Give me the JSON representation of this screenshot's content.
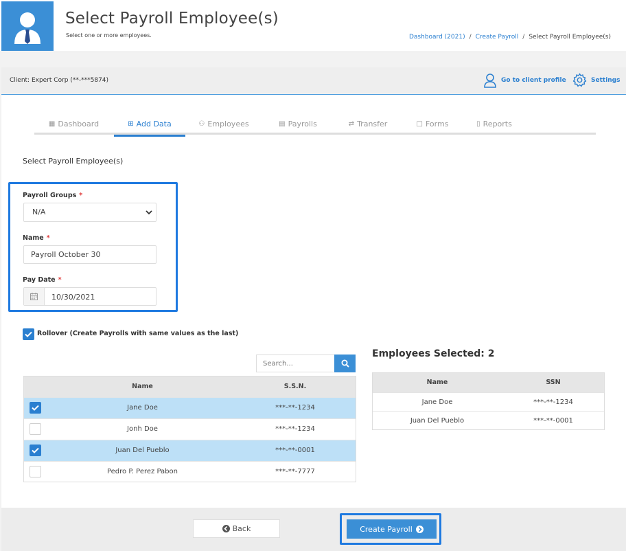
{
  "header": {
    "title": "Select Payroll Employee(s)",
    "subtitle": "Select one or more employees.",
    "breadcrumb": [
      {
        "label": "Dashboard (2021)",
        "link": true
      },
      {
        "label": "Create Payroll",
        "link": true
      },
      {
        "label": "Select Payroll Employee(s)",
        "link": false
      }
    ],
    "breadcrumb_sep": "/"
  },
  "client_bar": {
    "client_label": "Client: Expert Corp (**-***5874)",
    "profile_label": "Go to client profile",
    "settings_label": "Settings"
  },
  "tabs": [
    {
      "label": "Dashboard",
      "icon": "grid-icon",
      "active": false
    },
    {
      "label": "Add Data",
      "icon": "plus-square-icon",
      "active": true
    },
    {
      "label": "Employees",
      "icon": "users-icon",
      "active": false
    },
    {
      "label": "Payrolls",
      "icon": "money-icon",
      "active": false
    },
    {
      "label": "Transfer",
      "icon": "exchange-icon",
      "active": false
    },
    {
      "label": "Forms",
      "icon": "file-icon",
      "active": false
    },
    {
      "label": "Reports",
      "icon": "clipboard-icon",
      "active": false
    }
  ],
  "form": {
    "section_title": "Select Payroll Employee(s)",
    "payroll_groups_label": "Payroll Groups",
    "payroll_groups_value": "N/A",
    "name_label": "Name",
    "name_value": "Payroll October 30",
    "pay_date_label": "Pay Date",
    "pay_date_value": "10/30/2021",
    "required_mark": "*",
    "rollover_label": "Rollover (Create Payrolls with same values as the last)",
    "rollover_checked": true
  },
  "search": {
    "placeholder": "Search..."
  },
  "employees_table": {
    "columns": [
      "Name",
      "S.S.N."
    ],
    "rows": [
      {
        "name": "Jane Doe",
        "ssn": "***-**-1234",
        "checked": true
      },
      {
        "name": "Jonh Doe",
        "ssn": "***-**-1234",
        "checked": false
      },
      {
        "name": "Juan Del Pueblo",
        "ssn": "***-**-0001",
        "checked": true
      },
      {
        "name": "Pedro P. Perez Pabon",
        "ssn": "***-**-7777",
        "checked": false
      }
    ]
  },
  "selected": {
    "title": "Employees Selected: 2",
    "columns": [
      "Name",
      "SSN"
    ],
    "rows": [
      {
        "name": "Jane Doe",
        "ssn": "***-**-1234"
      },
      {
        "name": "Juan Del Pueblo",
        "ssn": "***-**-0001"
      }
    ]
  },
  "footer": {
    "back_label": "Back",
    "create_label": "Create Payroll"
  },
  "colors": {
    "accent": "#2a7fd0",
    "highlight_outline": "#1f7ae0",
    "selected_row": "#bde0f7"
  }
}
